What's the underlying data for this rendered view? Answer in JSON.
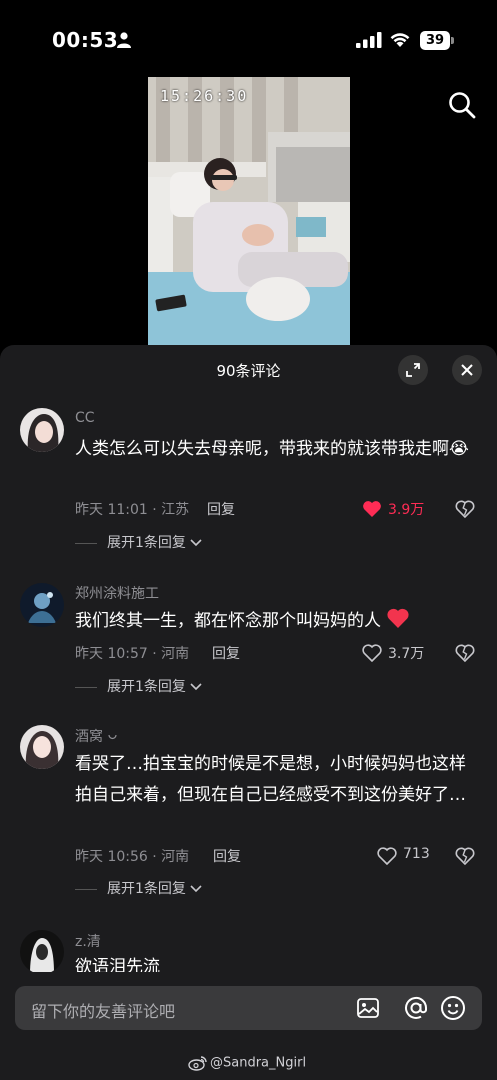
{
  "status_bar": {
    "time": "00:53",
    "battery": "39"
  },
  "video": {
    "timestamp": "15:26:30"
  },
  "panel": {
    "title": "90条评论"
  },
  "comments": [
    {
      "username": "CC",
      "text": "人类怎么可以失去母亲呢，带我来的就该带我走啊😭",
      "time_location": "昨天 11:01 · 江苏",
      "reply_label": "回复",
      "likes": "3.9万",
      "liked": true,
      "expand_label": "展开1条回复"
    },
    {
      "username": "郑州涂料施工",
      "text": "我们终其一生，都在怀念那个叫妈妈的人",
      "time_location": "昨天 10:57 · 河南",
      "reply_label": "回复",
      "likes": "3.7万",
      "liked": false,
      "expand_label": "展开1条回复"
    },
    {
      "username": "酒窝",
      "text": "看哭了…拍宝宝的时候是不是想，小时候妈妈也这样拍自己来着，但现在自己已经感受不到这份美好了…",
      "time_location": "昨天 10:56 · 河南",
      "reply_label": "回复",
      "likes": "713",
      "liked": false,
      "expand_label": "展开1条回复"
    },
    {
      "username": "z.清",
      "text": "欲语泪先流"
    }
  ],
  "input": {
    "placeholder": "留下你的友善评论吧"
  },
  "watermark": "@Sandra_Ngirl",
  "colors": {
    "panel_bg": "#1c1c1e",
    "like_red": "#fe2c55",
    "muted_text": "#8e8e93"
  }
}
